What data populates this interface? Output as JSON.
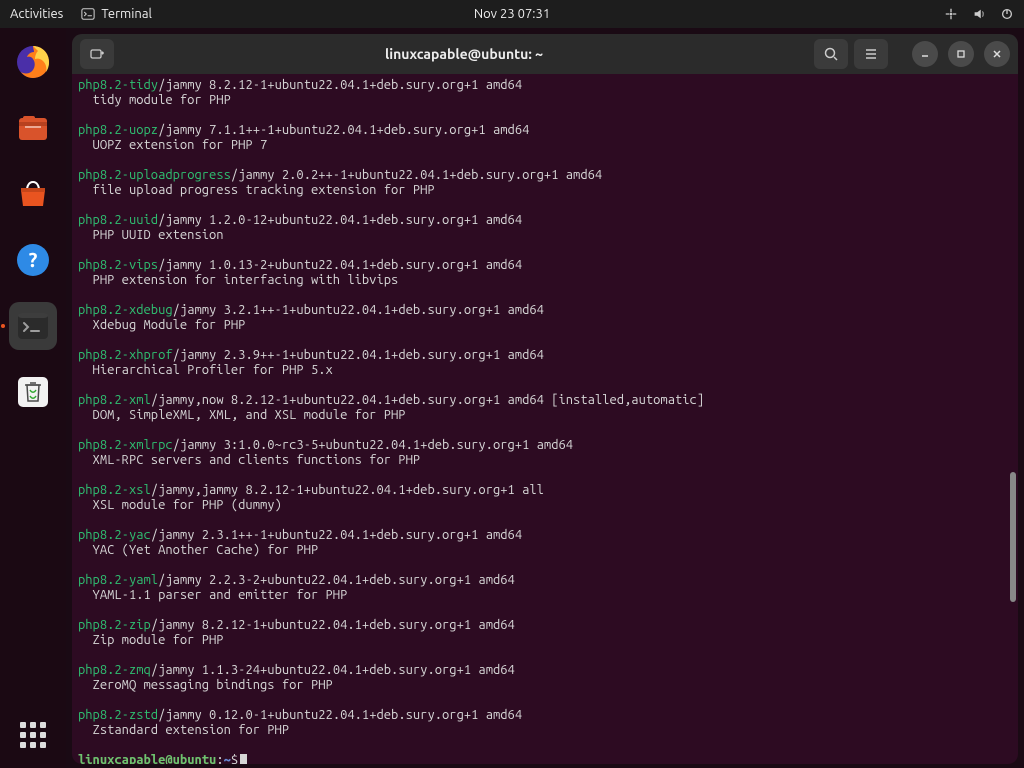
{
  "topbar": {
    "activities": "Activities",
    "app_name": "Terminal",
    "datetime": "Nov 23  07:31"
  },
  "window": {
    "title": "linuxcapable@ubuntu: ~"
  },
  "packages": [
    {
      "name": "php8.2-tidy",
      "meta": "/jammy 8.2.12-1+ubuntu22.04.1+deb.sury.org+1 amd64",
      "desc": "tidy module for PHP"
    },
    {
      "name": "php8.2-uopz",
      "meta": "/jammy 7.1.1++-1+ubuntu22.04.1+deb.sury.org+1 amd64",
      "desc": "UOPZ extension for PHP 7"
    },
    {
      "name": "php8.2-uploadprogress",
      "meta": "/jammy 2.0.2++-1+ubuntu22.04.1+deb.sury.org+1 amd64",
      "desc": "file upload progress tracking extension for PHP"
    },
    {
      "name": "php8.2-uuid",
      "meta": "/jammy 1.2.0-12+ubuntu22.04.1+deb.sury.org+1 amd64",
      "desc": "PHP UUID extension"
    },
    {
      "name": "php8.2-vips",
      "meta": "/jammy 1.0.13-2+ubuntu22.04.1+deb.sury.org+1 amd64",
      "desc": "PHP extension for interfacing with libvips"
    },
    {
      "name": "php8.2-xdebug",
      "meta": "/jammy 3.2.1++-1+ubuntu22.04.1+deb.sury.org+1 amd64",
      "desc": "Xdebug Module for PHP"
    },
    {
      "name": "php8.2-xhprof",
      "meta": "/jammy 2.3.9++-1+ubuntu22.04.1+deb.sury.org+1 amd64",
      "desc": "Hierarchical Profiler for PHP 5.x"
    },
    {
      "name": "php8.2-xml",
      "meta": "/jammy,now 8.2.12-1+ubuntu22.04.1+deb.sury.org+1 amd64 [installed,automatic]",
      "desc": "DOM, SimpleXML, XML, and XSL module for PHP"
    },
    {
      "name": "php8.2-xmlrpc",
      "meta": "/jammy 3:1.0.0~rc3-5+ubuntu22.04.1+deb.sury.org+1 amd64",
      "desc": "XML-RPC servers and clients functions for PHP"
    },
    {
      "name": "php8.2-xsl",
      "meta": "/jammy,jammy 8.2.12-1+ubuntu22.04.1+deb.sury.org+1 all",
      "desc": "XSL module for PHP (dummy)"
    },
    {
      "name": "php8.2-yac",
      "meta": "/jammy 2.3.1++-1+ubuntu22.04.1+deb.sury.org+1 amd64",
      "desc": "YAC (Yet Another Cache) for PHP"
    },
    {
      "name": "php8.2-yaml",
      "meta": "/jammy 2.2.3-2+ubuntu22.04.1+deb.sury.org+1 amd64",
      "desc": "YAML-1.1 parser and emitter for PHP"
    },
    {
      "name": "php8.2-zip",
      "meta": "/jammy 8.2.12-1+ubuntu22.04.1+deb.sury.org+1 amd64",
      "desc": "Zip module for PHP"
    },
    {
      "name": "php8.2-zmq",
      "meta": "/jammy 1.1.3-24+ubuntu22.04.1+deb.sury.org+1 amd64",
      "desc": "ZeroMQ messaging bindings for PHP"
    },
    {
      "name": "php8.2-zstd",
      "meta": "/jammy 0.12.0-1+ubuntu22.04.1+deb.sury.org+1 amd64",
      "desc": "Zstandard extension for PHP"
    }
  ],
  "prompt": {
    "user_host": "linuxcapable@ubuntu",
    "colon": ":",
    "path": "~",
    "dollar": "$"
  }
}
